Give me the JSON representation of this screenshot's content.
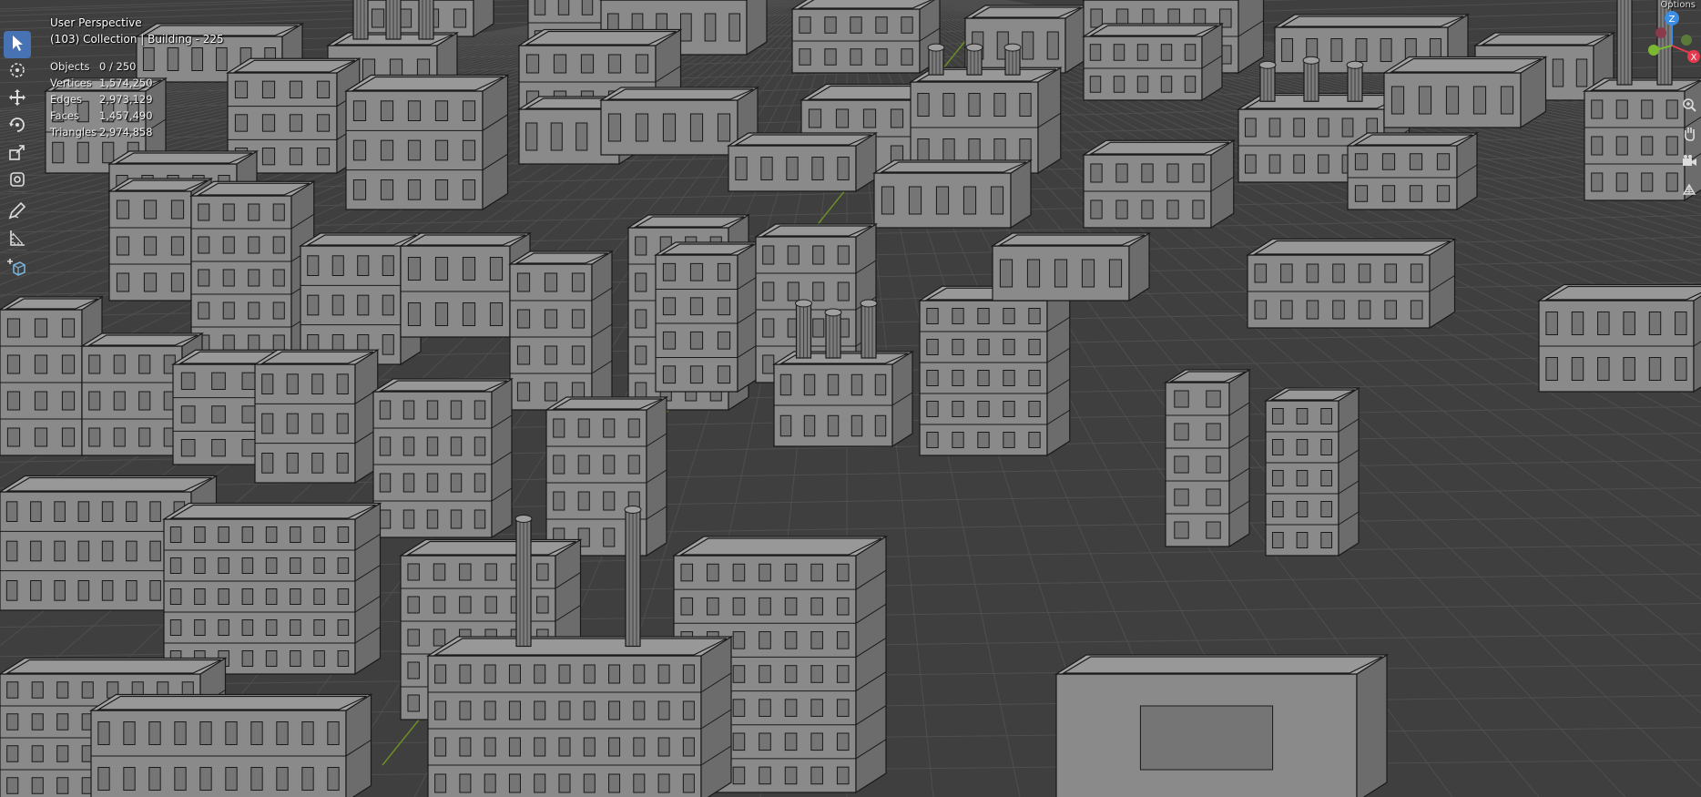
{
  "viewport": {
    "view_name": "User Perspective",
    "collection_info": "(103) Collection | Building - 225",
    "corner_label": "Options"
  },
  "stats": [
    {
      "label": "Objects",
      "value": "0 / 250"
    },
    {
      "label": "Vertices",
      "value": "1,574,250"
    },
    {
      "label": "Edges",
      "value": "2,973,129"
    },
    {
      "label": "Faces",
      "value": "1,457,490"
    },
    {
      "label": "Triangles",
      "value": "2,974,858"
    }
  ],
  "toolbar": [
    {
      "name": "select-box-tool",
      "icon": "cursor-arrow-icon",
      "active": true
    },
    {
      "name": "cursor-tool",
      "icon": "crosshair-circle-icon",
      "active": false
    },
    {
      "name": "move-tool",
      "icon": "move-arrows-icon",
      "active": false
    },
    {
      "name": "rotate-tool",
      "icon": "rotate-icon",
      "active": false
    },
    {
      "name": "scale-tool",
      "icon": "scale-icon",
      "active": false
    },
    {
      "name": "transform-tool",
      "icon": "transform-icon",
      "active": false
    },
    {
      "name": "annotate-tool",
      "icon": "pencil-icon",
      "active": false
    },
    {
      "name": "measure-tool",
      "icon": "ruler-icon",
      "active": false
    },
    {
      "name": "add-cube-tool",
      "icon": "add-cube-icon",
      "active": false
    }
  ],
  "navigation": [
    {
      "name": "zoom-button",
      "icon": "zoom-icon"
    },
    {
      "name": "pan-button",
      "icon": "hand-icon"
    },
    {
      "name": "camera-view-button",
      "icon": "camera-icon"
    },
    {
      "name": "ortho-toggle-button",
      "icon": "grid-icon"
    }
  ],
  "gizmo": {
    "axis_labels": [
      "Z",
      "X",
      "Y"
    ],
    "colors": {
      "x": "#e83a4e",
      "y": "#7ab831",
      "z": "#3c8ee4"
    }
  },
  "colors": {
    "viewport_bg": "#3f3f3f",
    "grid_line": "#4f4f4f",
    "building_face": "#8a8a8a",
    "building_top": "#a3a3a3",
    "building_side": "#6e6e6e",
    "wire": "#1a1a1a",
    "active_tool": "#4772b3",
    "axis_x": "#8d2a35",
    "axis_y": "#6a8f27"
  }
}
